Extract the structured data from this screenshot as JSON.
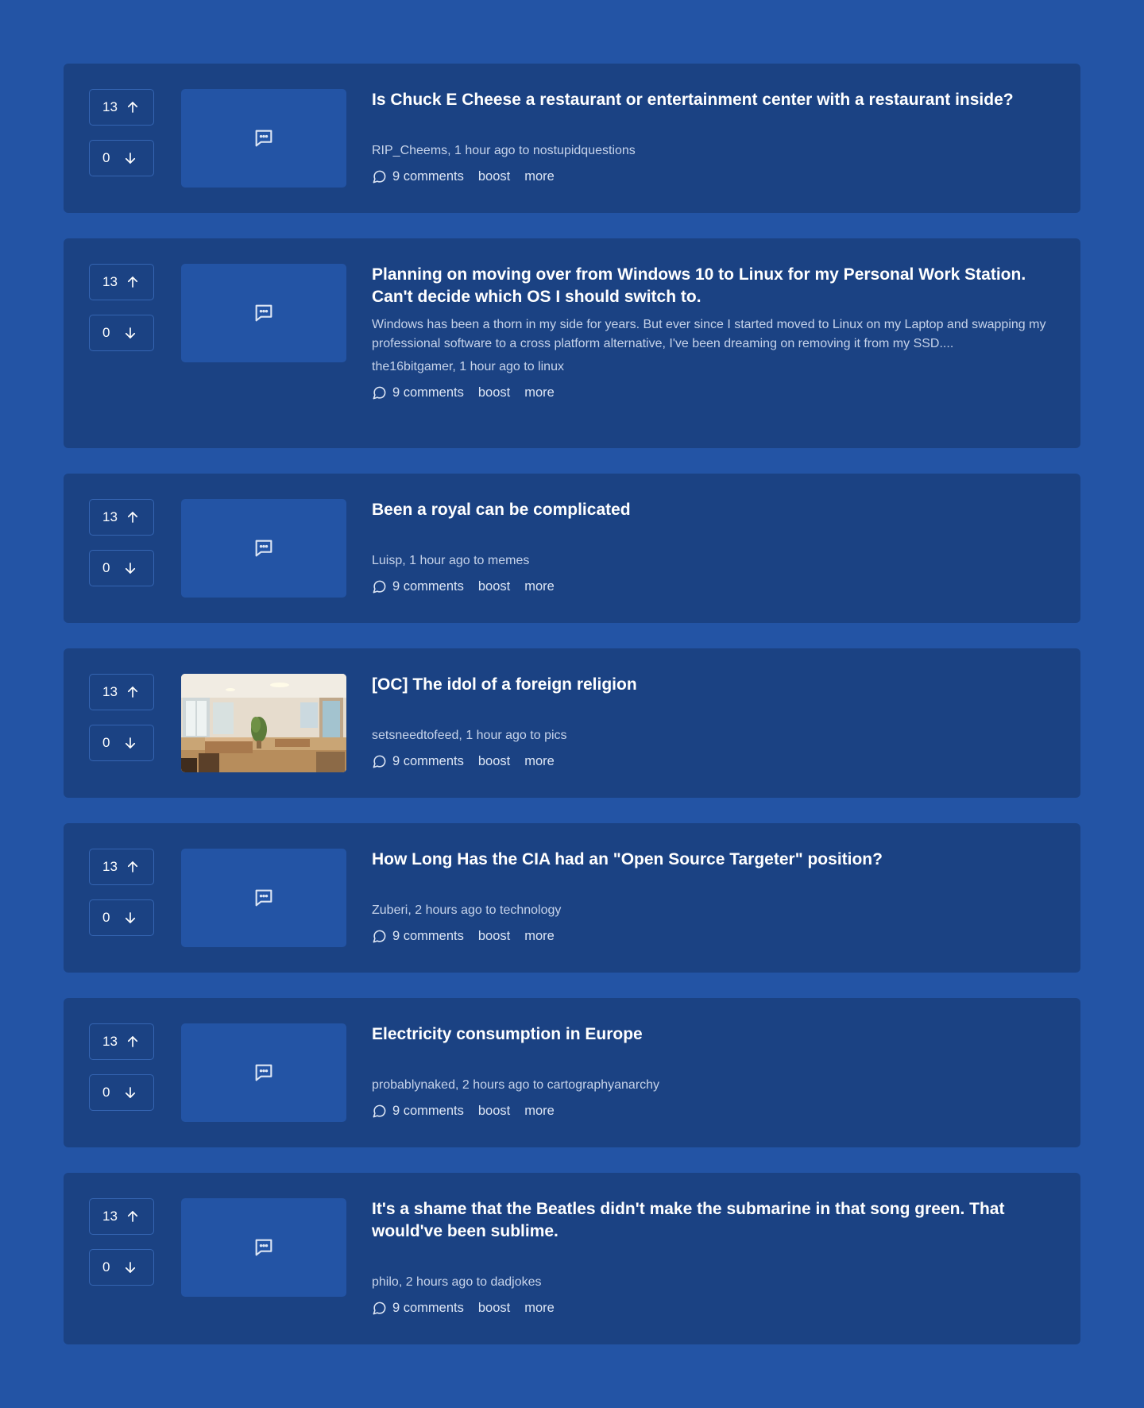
{
  "posts": [
    {
      "upvotes": "13",
      "downvotes": "0",
      "thumbnail": "comment-placeholder-icon",
      "title": "Is Chuck E Cheese a restaurant or entertainment center with a restaurant inside?",
      "excerpt": "",
      "author": "RIP_Cheems",
      "time": "1 hour ago",
      "to": "to",
      "community": "nostupidquestions",
      "comments_label": "9 comments",
      "boost_label": "boost",
      "more_label": "more"
    },
    {
      "upvotes": "13",
      "downvotes": "0",
      "thumbnail": "comment-placeholder-icon",
      "title": "Planning on moving over from Windows 10 to Linux for my Personal Work Station. Can't decide which OS I should switch to.",
      "excerpt": "Windows has been a thorn in my side for years. But ever since I started moved to Linux on my Laptop and swapping my professional software to a cross platform alternative, I've been dreaming on removing it from my SSD....",
      "author": "the16bitgamer",
      "time": "1 hour ago",
      "to": "to",
      "community": "linux",
      "comments_label": "9 comments",
      "boost_label": "boost",
      "more_label": "more"
    },
    {
      "upvotes": "13",
      "downvotes": "0",
      "thumbnail": "comment-placeholder-icon",
      "title": "Been a royal can be complicated",
      "excerpt": "",
      "author": "Luisp",
      "time": "1 hour ago",
      "to": "to",
      "community": "memes",
      "comments_label": "9 comments",
      "boost_label": "boost",
      "more_label": "more"
    },
    {
      "upvotes": "13",
      "downvotes": "0",
      "thumbnail": "office-interior-photo",
      "title": "[OC] The idol of a foreign religion",
      "excerpt": "",
      "author": "setsneedtofeed",
      "time": "1 hour ago",
      "to": "to",
      "community": "pics",
      "comments_label": "9 comments",
      "boost_label": "boost",
      "more_label": "more"
    },
    {
      "upvotes": "13",
      "downvotes": "0",
      "thumbnail": "comment-placeholder-icon",
      "title": "How Long Has the CIA had an \"Open Source Targeter\" position?",
      "excerpt": "",
      "author": "Zuberi",
      "time": "2 hours ago",
      "to": "to",
      "community": "technology",
      "comments_label": "9 comments",
      "boost_label": "boost",
      "more_label": "more"
    },
    {
      "upvotes": "13",
      "downvotes": "0",
      "thumbnail": "comment-placeholder-icon",
      "title": "Electricity consumption in Europe",
      "excerpt": "",
      "author": "probablynaked",
      "time": "2 hours ago",
      "to": "to",
      "community": "cartographyanarchy",
      "comments_label": "9 comments",
      "boost_label": "boost",
      "more_label": "more"
    },
    {
      "upvotes": "13",
      "downvotes": "0",
      "thumbnail": "comment-placeholder-icon",
      "title": "It's a shame that the Beatles didn't make the submarine in that song green. That would've been sublime.",
      "excerpt": "",
      "author": "philo",
      "time": "2 hours ago",
      "to": "to",
      "community": "dadjokes",
      "comments_label": "9 comments",
      "boost_label": "boost",
      "more_label": "more"
    }
  ],
  "colors": {
    "page_background": "#2354a5",
    "card_background": "#1b4283",
    "muted_text": "#c6d3ea"
  }
}
